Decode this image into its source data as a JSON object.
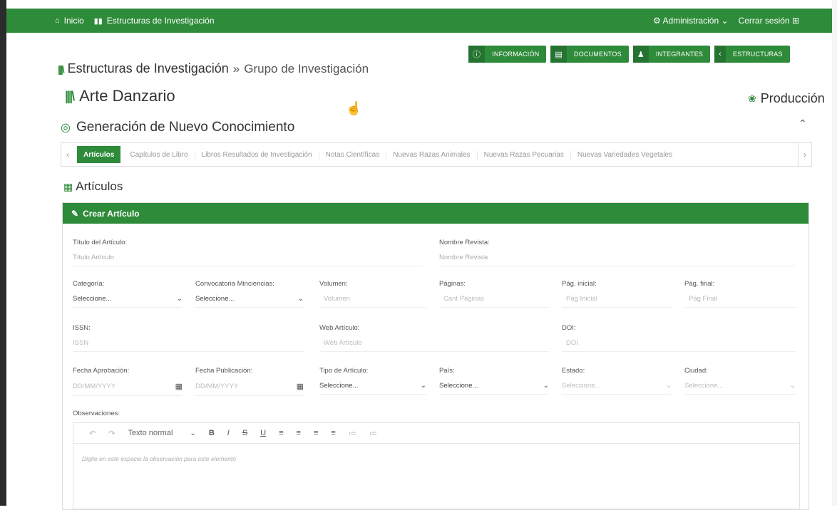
{
  "topbar": {
    "home_label": "Inicio",
    "estructuras_label": "Estructuras de Investigación",
    "admin_label": "Administración",
    "logout_label": "Cerrar sesión"
  },
  "header": {
    "title": "Estructuras de Investigación",
    "separator": "»",
    "subtitle": "Grupo de Investigación",
    "buttons": [
      "INFORMACIÓN",
      "DOCUMENTOS",
      "INTEGRANTES",
      "ESTRUCTURAS"
    ]
  },
  "group": {
    "name": "Arte Danzario",
    "produccion": "Producción",
    "category": "Generación de Nuevo Conocimiento"
  },
  "tabs": [
    "Artículos",
    "Capítulos de Libro",
    "Libros Resultados de Investigación",
    "Notas Científicas",
    "Nuevas Razas Animales",
    "Nuevas Razas Pecuarias",
    "Nuevas Variedades Vegetales"
  ],
  "section_title": "Artículos",
  "panel_title": "Crear Artículo",
  "form": {
    "titulo": {
      "label": "Título del Artículo:",
      "placeholder": "Título Artículo"
    },
    "revista": {
      "label": "Nombre Revista:",
      "placeholder": "Nombre Revista"
    },
    "categoria": {
      "label": "Categoría:",
      "value": "Seleccione..."
    },
    "convocatoria": {
      "label": "Convocatoria Minciencias:",
      "value": "Seleccione..."
    },
    "volumen": {
      "label": "Volumen:",
      "placeholder": "Volumen"
    },
    "paginas": {
      "label": "Páginas:",
      "placeholder": "Cant Páginas"
    },
    "pag_inicial": {
      "label": "Pág. inicial:",
      "placeholder": "Pág Inicial"
    },
    "pag_final": {
      "label": "Pág. final:",
      "placeholder": "Pág Final"
    },
    "issn": {
      "label": "ISSN:",
      "placeholder": "ISSN"
    },
    "web": {
      "label": "Web Artículo:",
      "placeholder": "Web Artículo"
    },
    "doi": {
      "label": "DOI:",
      "placeholder": "DOI"
    },
    "fecha_aprobacion": {
      "label": "Fecha Aprobación:",
      "placeholder": "DD/MM/YYYY"
    },
    "fecha_publicacion": {
      "label": "Fecha Publicación:",
      "placeholder": "DD/MM/YYYY"
    },
    "tipo": {
      "label": "Tipo de Artículo:",
      "value": "Seleccione..."
    },
    "pais": {
      "label": "País:",
      "value": "Seleccione..."
    },
    "estado": {
      "label": "Estado:",
      "value": "Seleccione..."
    },
    "ciudad": {
      "label": "Ciudad:",
      "value": "Seleccione..."
    },
    "observaciones": {
      "label": "Observaciones:"
    }
  },
  "editor": {
    "style_value": "Texto normal",
    "placeholder": "Digite en este espacio la observación para este elemento"
  },
  "colors": {
    "accent": "#2e8b3a"
  }
}
